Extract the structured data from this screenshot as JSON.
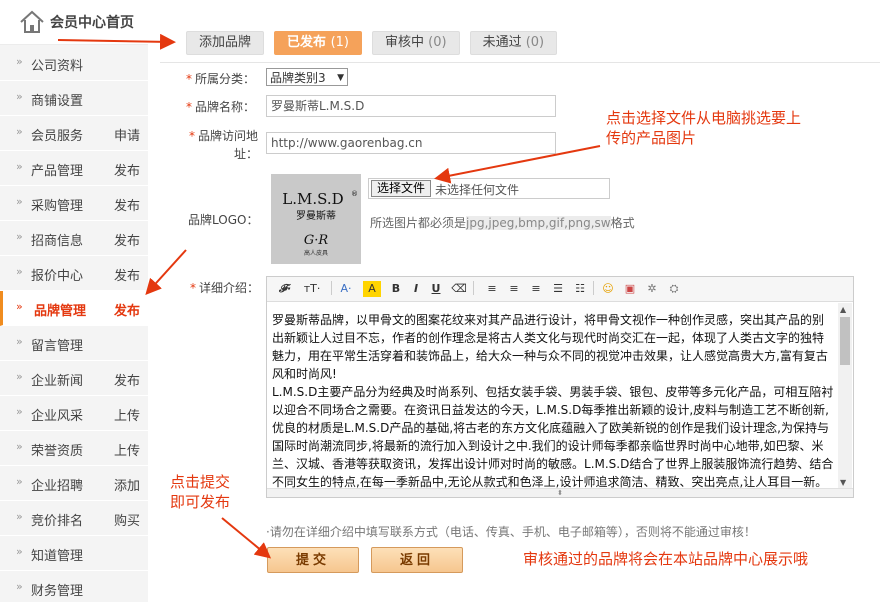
{
  "home": {
    "label": "会员中心首页"
  },
  "menu": [
    {
      "label": "公司资料",
      "action": ""
    },
    {
      "label": "商铺设置",
      "action": ""
    },
    {
      "label": "会员服务",
      "action": "申请"
    },
    {
      "label": "产品管理",
      "action": "发布"
    },
    {
      "label": "采购管理",
      "action": "发布"
    },
    {
      "label": "招商信息",
      "action": "发布"
    },
    {
      "label": "报价中心",
      "action": "发布"
    },
    {
      "label": "品牌管理",
      "action": "发布",
      "active": true
    },
    {
      "label": "留言管理",
      "action": ""
    },
    {
      "label": "企业新闻",
      "action": "发布"
    },
    {
      "label": "企业风采",
      "action": "上传"
    },
    {
      "label": "荣誉资质",
      "action": "上传"
    },
    {
      "label": "企业招聘",
      "action": "添加"
    },
    {
      "label": "竞价排名",
      "action": "购买"
    },
    {
      "label": "知道管理",
      "action": ""
    },
    {
      "label": "财务管理",
      "action": ""
    }
  ],
  "tabs": [
    {
      "label": "添加品牌",
      "count": ""
    },
    {
      "label": "已发布",
      "count": "(1)",
      "active": true
    },
    {
      "label": "审核中",
      "count": "(0)"
    },
    {
      "label": "未通过",
      "count": "(0)"
    }
  ],
  "form": {
    "category_label": "所属分类：",
    "category_value": "品牌类别3",
    "name_label": "品牌名称：",
    "name_value": "罗曼斯蒂L.M.S.D",
    "url_label_1": "品牌访问地",
    "url_label_2": "址：",
    "url_value": "http://www.gaorenbag.cn",
    "logo_label": "品牌LOGO：",
    "logo_text_1": "L.M.S.D",
    "logo_reg": "®",
    "logo_text_2": "罗曼斯蒂",
    "logo_text_3": "G·R",
    "logo_text_4": "高人皮具",
    "file_button": "选择文件",
    "file_none": "未选择任何文件",
    "hint_prefix": "所选图片都必须是",
    "hint_ext": "jpg,jpeg,bmp,gif,png,sw",
    "hint_suffix": "格式",
    "detail_label": "详细介绍："
  },
  "editor": {
    "paragraph_1": " 罗曼斯蒂品牌，以甲骨文的图案花纹来对其产品进行设计，将甲骨文视作一种创作灵感，突出其产品的别出新颖让人过目不忘，作者的创作理念是将古人类文化与现代时尚交汇在一起，体现了人类古文字的独特魅力，用在平常生活穿着和装饰品上，给大众一种与众不同的视觉冲击效果，让人感觉高贵大方,富有复古风和时尚风!",
    "paragraph_2": "L.M.S.D主要产品分为经典及时尚系列、包括女装手袋、男装手袋、银包、皮带等多元化产品，可相互陪衬以迎合不同场合之需要。在资讯日益发达的今天，L.M.S.D每季推出新颖的设计,皮料与制造工艺不断创新,优良的材质是L.M.S.D产品的基础,将古老的东方文化底蕴融入了欧美新锐的创作是我们设计理念,为保持与国际时尚潮流同步,将最新的流行加入到设计之中.我们的设计师每季都亲临世界时尚中心地带,如巴黎、米兰、汉城、香港等获取资讯，发挥出设计师对时尚的敏感。L.M.S.D结合了世界上服装服饰流行趋势、结合不同女生的特点,在每一季新品中,无论从款式和色泽上,设计师追求简洁、精致、突出亮点,让人耳目一新。"
  },
  "note": "·请勿在详细介绍中填写联系方式（电话、传真、手机、电子邮箱等），否则将不能通过审核！",
  "buttons": {
    "submit": "提交",
    "back": "返回"
  },
  "annotations": {
    "choose_file": [
      "点击选择文件从电脑挑选要上",
      "传的产品图片"
    ],
    "submit_hint": [
      "点击提交",
      "即可发布"
    ],
    "review_hint": "审核通过的品牌将会在本站品牌中心展示哦"
  },
  "colors": {
    "accent": "#e4380f",
    "tab_active": "#f5a25a",
    "sidebar_bg": "#f4f4f4"
  }
}
